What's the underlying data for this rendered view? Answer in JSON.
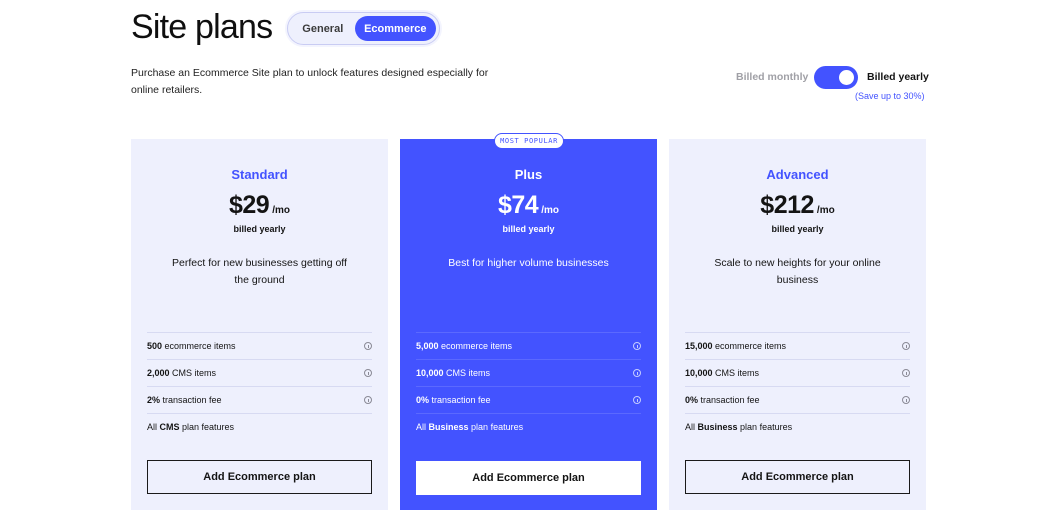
{
  "header": {
    "title": "Site plans",
    "tabs": [
      {
        "label": "General",
        "active": false
      },
      {
        "label": "Ecommerce",
        "active": true
      }
    ],
    "description": "Purchase an Ecommerce Site plan to unlock features designed especially for online retailers."
  },
  "billing": {
    "monthly_label": "Billed monthly",
    "yearly_label": "Billed yearly",
    "save_note": "(Save up to 30%)",
    "yearly_selected": true
  },
  "colors": {
    "accent": "#4353ff",
    "card_bg": "#eef0fd"
  },
  "plans": [
    {
      "name": "Standard",
      "price": "$29",
      "per": "/mo",
      "billed": "billed yearly",
      "tagline": "Perfect for new businesses getting off the ground",
      "features": [
        {
          "bold": "500",
          "text": " ecommerce items",
          "info": true
        },
        {
          "bold": "2,000",
          "text": " CMS items",
          "info": true
        },
        {
          "bold": "2%",
          "text": " transaction fee",
          "info": true
        },
        {
          "prefix": "All ",
          "bold": "CMS",
          "text": " plan features",
          "info": false
        }
      ],
      "cta": "Add Ecommerce plan"
    },
    {
      "name": "Plus",
      "badge": "MOST POPULAR",
      "price": "$74",
      "per": "/mo",
      "billed": "billed yearly",
      "tagline": "Best for higher volume businesses",
      "features": [
        {
          "bold": "5,000",
          "text": " ecommerce items",
          "info": true
        },
        {
          "bold": "10,000",
          "text": " CMS items",
          "info": true
        },
        {
          "bold": "0%",
          "text": " transaction fee",
          "info": true
        },
        {
          "prefix": "All ",
          "bold": "Business",
          "text": " plan features",
          "info": false
        }
      ],
      "cta": "Add Ecommerce plan"
    },
    {
      "name": "Advanced",
      "price": "$212",
      "per": "/mo",
      "billed": "billed yearly",
      "tagline": "Scale to new heights for your online business",
      "features": [
        {
          "bold": "15,000",
          "text": " ecommerce items",
          "info": true
        },
        {
          "bold": "10,000",
          "text": " CMS items",
          "info": true
        },
        {
          "bold": "0%",
          "text": " transaction fee",
          "info": true
        },
        {
          "prefix": "All ",
          "bold": "Business",
          "text": " plan features",
          "info": false
        }
      ],
      "cta": "Add Ecommerce plan"
    }
  ]
}
